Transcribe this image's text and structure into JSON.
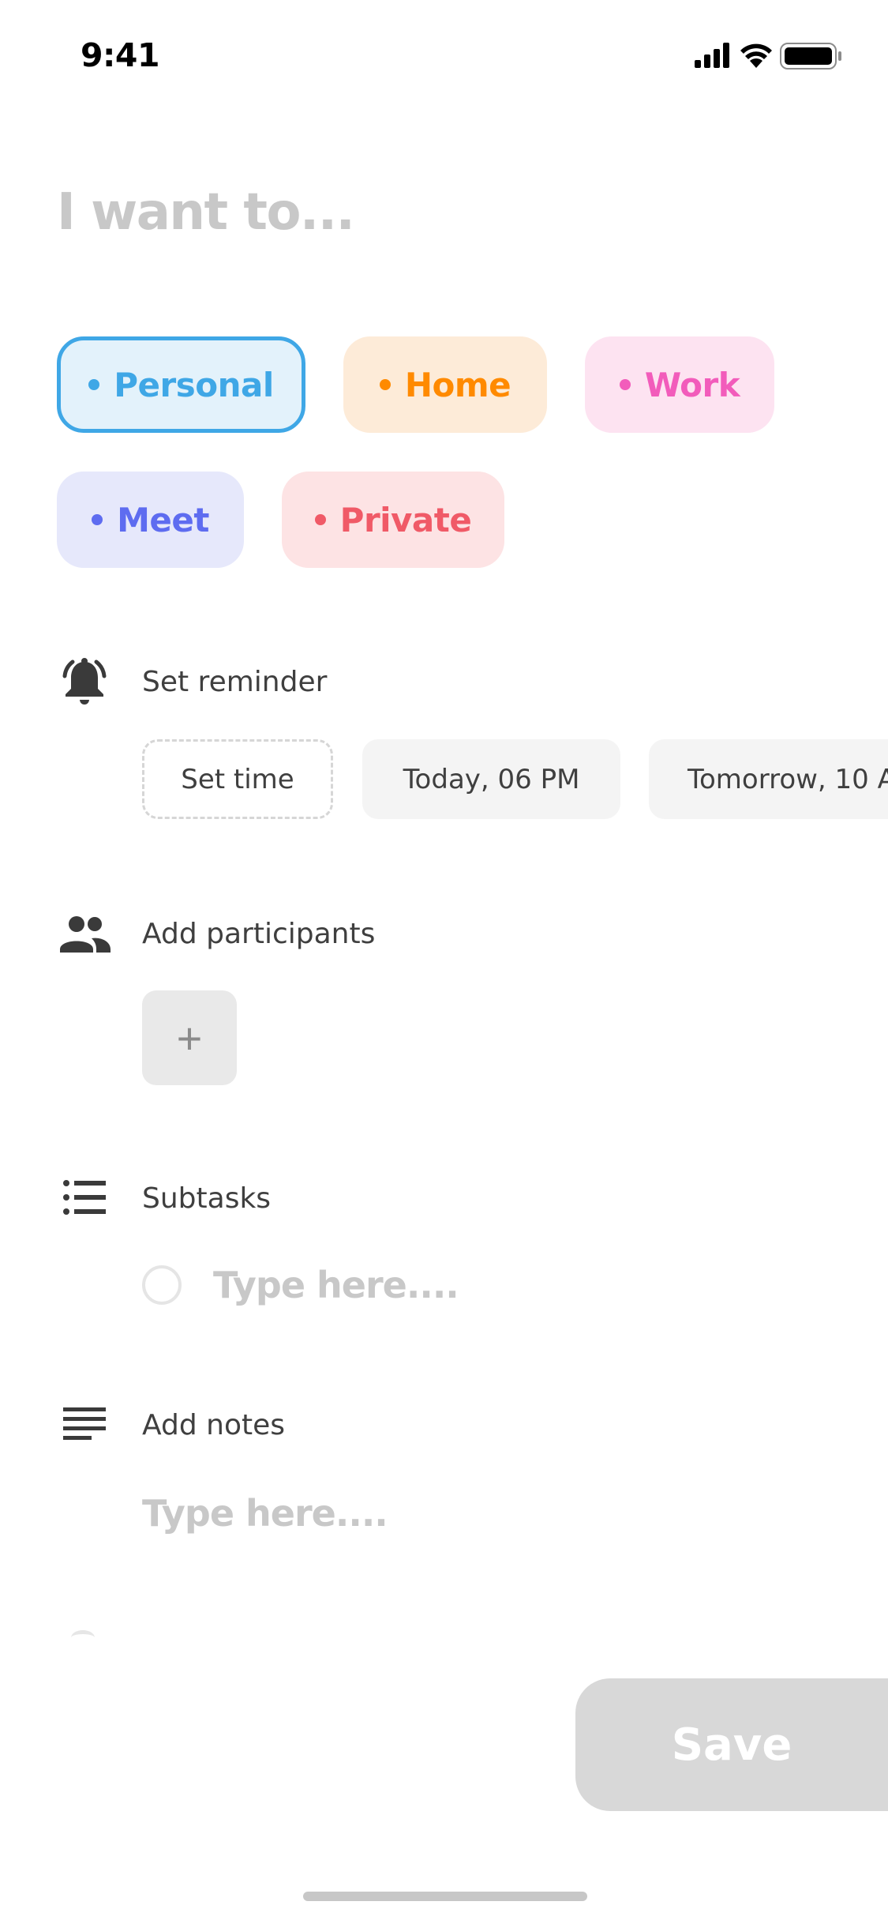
{
  "status_bar": {
    "time": "9:41",
    "icons": [
      "signal-icon",
      "wifi-icon",
      "battery-icon"
    ]
  },
  "task": {
    "title_placeholder": "I want to..."
  },
  "categories": [
    {
      "label": "Personal",
      "text_color": "#3fa7e6",
      "bg": "#e3f2fb",
      "border": "#3fa7e6",
      "selected": true
    },
    {
      "label": "Home",
      "text_color": "#ff8a00",
      "bg": "#fdebd8",
      "border": "",
      "selected": false
    },
    {
      "label": "Work",
      "text_color": "#f25cbb",
      "bg": "#fde3f1",
      "border": "",
      "selected": false
    },
    {
      "label": "Meet",
      "text_color": "#5e6cf0",
      "bg": "#e6e8fb",
      "border": "",
      "selected": false
    },
    {
      "label": "Private",
      "text_color": "#f05a67",
      "bg": "#fde3e4",
      "border": "",
      "selected": false
    }
  ],
  "reminder": {
    "label": "Set reminder",
    "icon": "bell-icon",
    "options": [
      "Set time",
      "Today, 06 PM",
      "Tomorrow, 10 A"
    ]
  },
  "participants": {
    "label": "Add participants",
    "icon": "people-icon",
    "add_symbol": "+"
  },
  "subtasks": {
    "label": "Subtasks",
    "icon": "list-icon",
    "placeholder": "Type here...."
  },
  "notes": {
    "label": "Add notes",
    "icon": "notes-icon",
    "placeholder": "Type here...."
  },
  "save_label": "Save",
  "colors": {
    "placeholder": "#c8c8c8",
    "pill_bg": "#f4f4f4",
    "save_disabled": "#d8d8d8"
  }
}
